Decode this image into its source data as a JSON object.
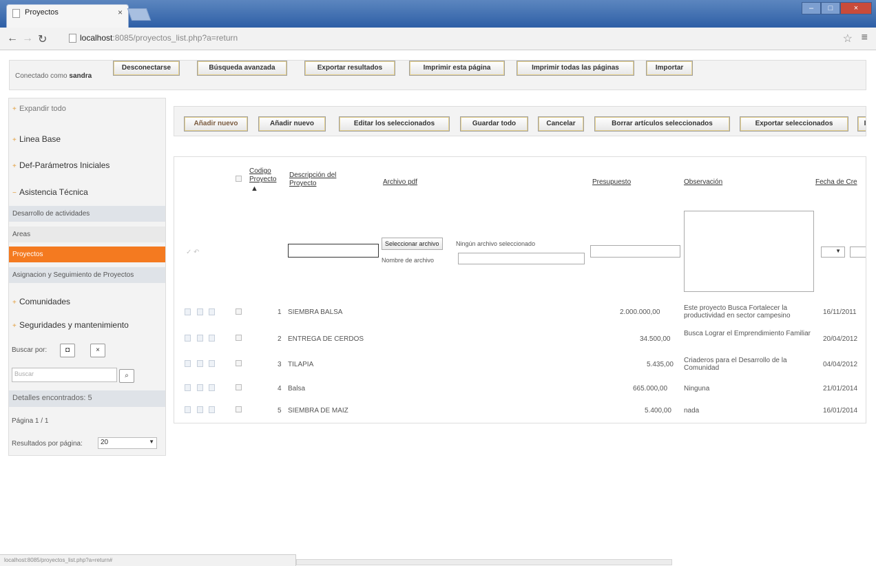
{
  "browser": {
    "tab_title": "Proyectos",
    "tab_close": "×",
    "url_host": "localhost",
    "url_rest": ":8085/proyectos_list.php?a=return",
    "status_url": "localhost:8085/proyectos_list.php?a=return#"
  },
  "topbar": {
    "connected_label": "Conectado como",
    "user": "sandra",
    "logout": "Desconectarse",
    "advanced_search": "Búsqueda avanzada",
    "export_results": "Exportar resultados",
    "print_page": "Imprimir esta página",
    "print_all": "Imprimir todas las páginas",
    "import": "Importar"
  },
  "sidebar": {
    "expand_all": "Expandir todo",
    "items": [
      "Linea Base",
      "Def-Parámetros Iniciales",
      "Asistencia Técnica"
    ],
    "sub_items": [
      "Desarrollo de actividades",
      "Areas",
      "Proyectos",
      "Asignacion y Seguimiento de Proyectos"
    ],
    "more_items": [
      "Comunidades",
      "Seguridades y mantenimiento"
    ],
    "search_by": "Buscar por:",
    "search_placeholder": "Buscar",
    "found": "Detalles encontrados: 5",
    "page": "Página 1 / 1",
    "per_page_label": "Resultados por página:",
    "per_page_value": "20"
  },
  "actions": {
    "add_new_1": "Añadir nuevo",
    "add_new_2": "Añadir nuevo",
    "edit_selected": "Editar los seleccionados",
    "save_all": "Guardar todo",
    "cancel": "Cancelar",
    "delete_selected": "Borrar artículos seleccionados",
    "export_selected": "Exportar seleccionados",
    "cut": "I"
  },
  "table": {
    "headers": {
      "code_1": "Codigo",
      "code_2": "Proyecto",
      "desc_1": "Descripción del",
      "desc_2": "Proyecto",
      "pdf": "Archivo pdf",
      "budget": "Presupuesto",
      "obs": "Observación",
      "date": "Fecha de Cre"
    },
    "select_file": "Seleccionar archivo",
    "no_file": "Ningún archivo seleccionado",
    "file_name": "Nombre de archivo",
    "rows": [
      {
        "code": "1",
        "desc": "SIEMBRA BALSA",
        "budget": "2.000.000,00",
        "obs": "Este proyecto Busca Fortalecer la productividad en sector campesino",
        "date": "16/11/2011"
      },
      {
        "code": "2",
        "desc": "ENTREGA DE CERDOS",
        "budget": "34.500,00",
        "obs": "Busca Lograr el Emprendimiento Familiar",
        "date": "20/04/2012"
      },
      {
        "code": "3",
        "desc": "TILAPIA",
        "budget": "5.435,00",
        "obs": "Criaderos para el Desarrollo de la Comunidad",
        "date": "04/04/2012"
      },
      {
        "code": "4",
        "desc": "Balsa",
        "budget": "665.000,00",
        "obs": "Ninguna",
        "date": "21/01/2014"
      },
      {
        "code": "5",
        "desc": "SIEMBRA DE MAIZ",
        "budget": "5.400,00",
        "obs": "nada",
        "date": "16/01/2014"
      }
    ]
  }
}
